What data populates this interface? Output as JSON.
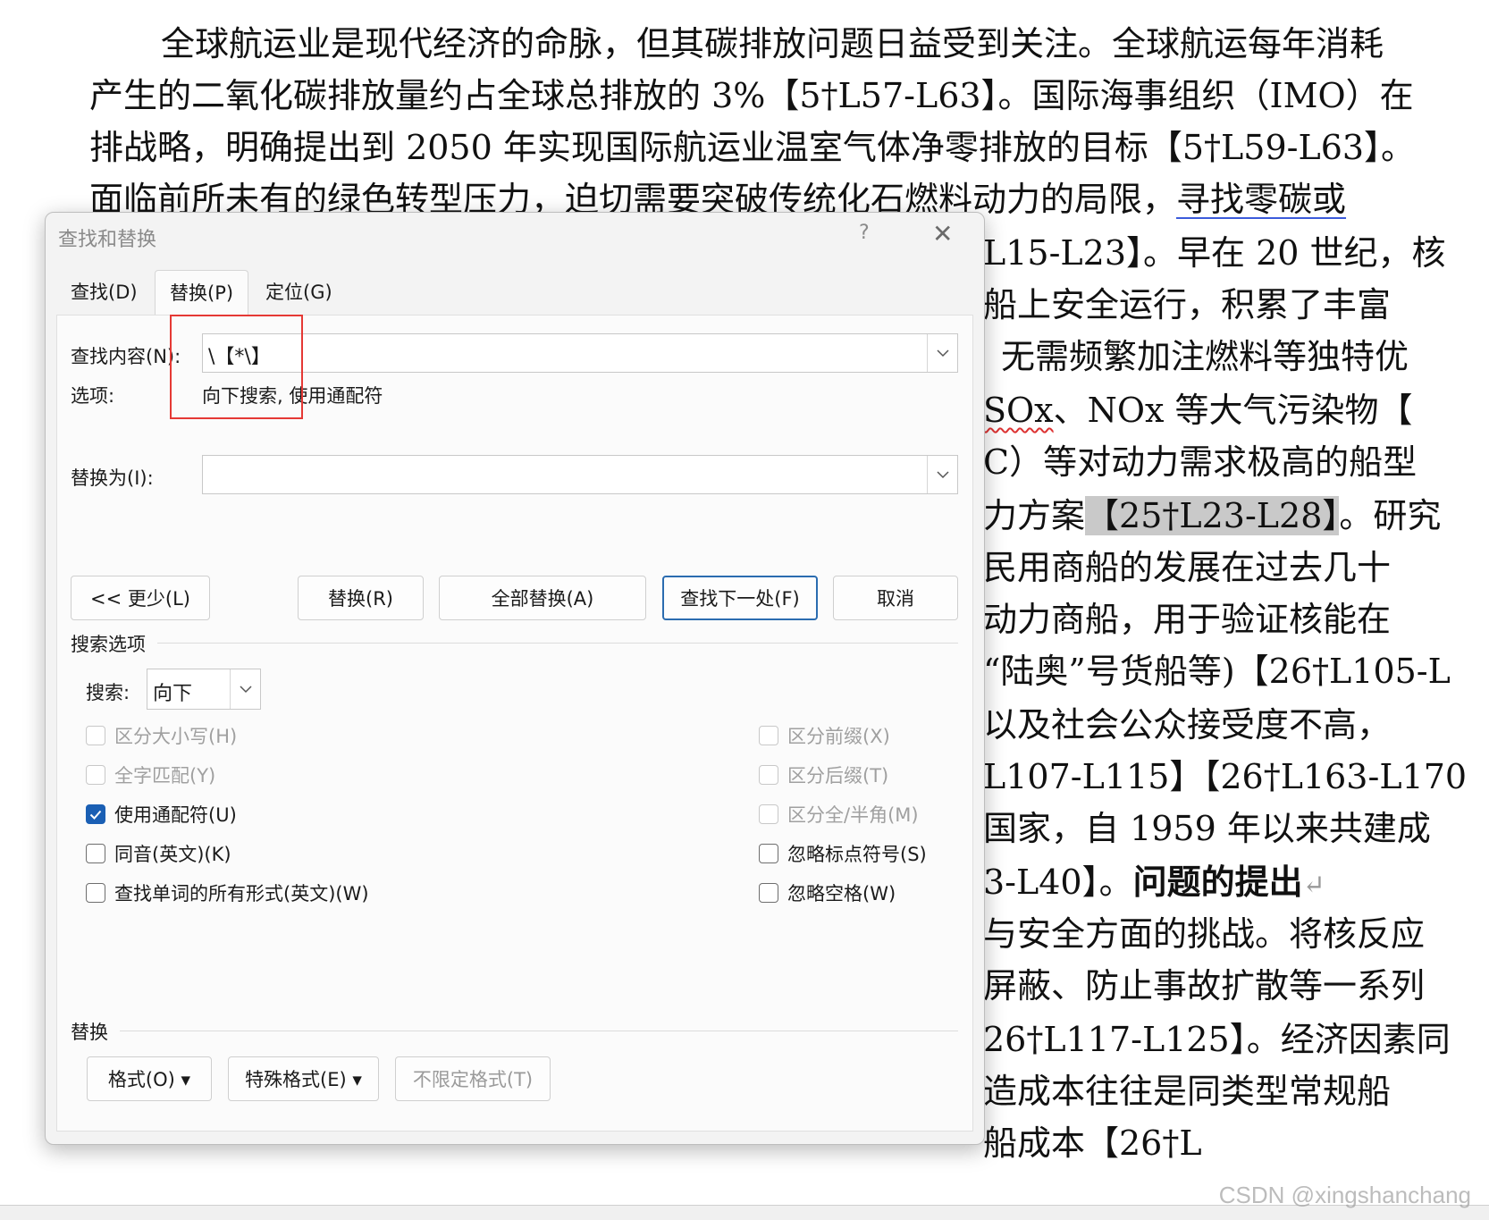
{
  "document": {
    "lines": [
      "全球航运业是现代经济的命脉，但其碳排放问题日益受到关注。全球航运每年消耗",
      "产生的二氧化碳排放量约占全球总排放的 3%【5†L57-L63】。国际海事组织（IMO）在",
      "排战略，明确提出到 2050 年实现国际航运业温室气体净零排放的目标【5†L59-L63】。",
      "面临前所未有的绿色转型压力，迫切需要突破传统化石燃料动力的局限，",
      "寻找零碳或",
      "L15-L23】。早在 20 世纪，核",
      "船上安全运行，积累了丰富",
      "无需频繁加注燃料等独特优",
      "SOx",
      "、NOx 等大气污染物【",
      "C）等对动力需求极高的船型",
      "力方案",
      "【25†L23-L28】",
      "。研究",
      "民用商船的发展在过去几十",
      "动力商船，用于验证核能在",
      "“陆奥”号货船等)【26†L105-L",
      "以及社会公众接受度不高，",
      "L107-L115】【26†L163-L170",
      "国家，自 1959 年以来共建成",
      "3-L40】。",
      "问题的提出",
      "与安全方面的挑战。将核反应",
      "屏蔽、防止事故扩散等一系列",
      "26†L117-L125】。经济因素同",
      "造成本往往是同类型常规船",
      "船成本【26†L"
    ],
    "watermark": "CSDN @xingshanchang"
  },
  "dialog": {
    "title": "查找和替换",
    "help": "?",
    "tabs": [
      "查找(D)",
      "替换(P)",
      "定位(G)"
    ],
    "find_label": "查找内容(N):",
    "find_value": "\\【*\\】",
    "options_label": "选项:",
    "options_value": "向下搜索, 使用通配符",
    "replace_label": "替换为(I):",
    "replace_value": "",
    "buttons": {
      "less": "<< 更少(L)",
      "replace": "替换(R)",
      "replace_all": "全部替换(A)",
      "find_next": "查找下一处(F)",
      "cancel": "取消"
    },
    "search_options_title": "搜索选项",
    "search_label": "搜索:",
    "search_value": "向下",
    "checkboxes_left": [
      {
        "label": "区分大小写(H)",
        "checked": false,
        "enabled": false
      },
      {
        "label": "全字匹配(Y)",
        "checked": false,
        "enabled": false
      },
      {
        "label": "使用通配符(U)",
        "checked": true,
        "enabled": true
      },
      {
        "label": "同音(英文)(K)",
        "checked": false,
        "enabled": true
      },
      {
        "label": "查找单词的所有形式(英文)(W)",
        "checked": false,
        "enabled": true
      }
    ],
    "checkboxes_right": [
      {
        "label": "区分前缀(X)",
        "checked": false,
        "enabled": false
      },
      {
        "label": "区分后缀(T)",
        "checked": false,
        "enabled": false
      },
      {
        "label": "区分全/半角(M)",
        "checked": false,
        "enabled": false
      },
      {
        "label": "忽略标点符号(S)",
        "checked": false,
        "enabled": true
      },
      {
        "label": "忽略空格(W)",
        "checked": false,
        "enabled": true
      }
    ],
    "replace_section_title": "替换",
    "bottom_buttons": {
      "format": "格式(O) ▾",
      "special": "特殊格式(E) ▾",
      "no_format": "不限定格式(T)"
    }
  },
  "colors": {
    "accent": "#1a5fb4",
    "highlight_box": "#e53935"
  }
}
